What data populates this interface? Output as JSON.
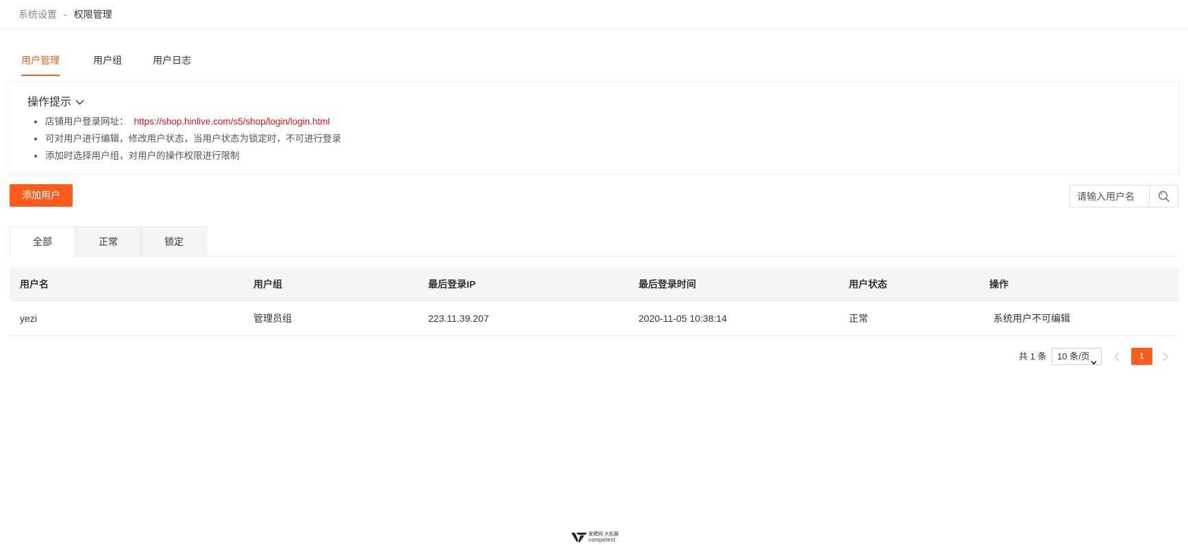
{
  "breadcrumb": {
    "parent": "系统设置",
    "separator": "-",
    "current": "权限管理"
  },
  "main_tabs": [
    {
      "label": "用户管理",
      "active": true
    },
    {
      "label": "用户组",
      "active": false
    },
    {
      "label": "用户日志",
      "active": false
    }
  ],
  "tips": {
    "title": "操作提示",
    "items": [
      {
        "text": "店铺用户登录网址：",
        "link": "https://shop.hinlive.com/s5/shop/login/login.html"
      },
      {
        "text": "可对用户进行编辑，修改用户状态，当用户状态为锁定时，不可进行登录"
      },
      {
        "text": "添加时选择用户组，对用户的操作权限进行限制"
      }
    ]
  },
  "toolbar": {
    "add_label": "添加用户"
  },
  "search": {
    "placeholder": "请输入用户名",
    "icon": "search-icon"
  },
  "filter_tabs": [
    {
      "label": "全部",
      "active": true
    },
    {
      "label": "正常",
      "active": false
    },
    {
      "label": "锁定",
      "active": false
    }
  ],
  "table": {
    "columns": [
      "用户名",
      "用户组",
      "最后登录IP",
      "最后登录时间",
      "用户状态",
      "操作"
    ],
    "rows": [
      {
        "username": "yezi",
        "group": "管理员组",
        "last_ip": "223.11.39.207",
        "last_time": "2020-11-05 10:38:14",
        "status": "正常",
        "action": "系统用户不可编辑"
      }
    ]
  },
  "pagination": {
    "total_text": "共 1 条",
    "page_size": "10 条/页",
    "current_page": "1"
  },
  "footer": {
    "logo_text": "爱聘网 大拓展",
    "logo_sub": "competent"
  },
  "colors": {
    "accent": "#ff5b1b",
    "link": "#e4141b"
  }
}
